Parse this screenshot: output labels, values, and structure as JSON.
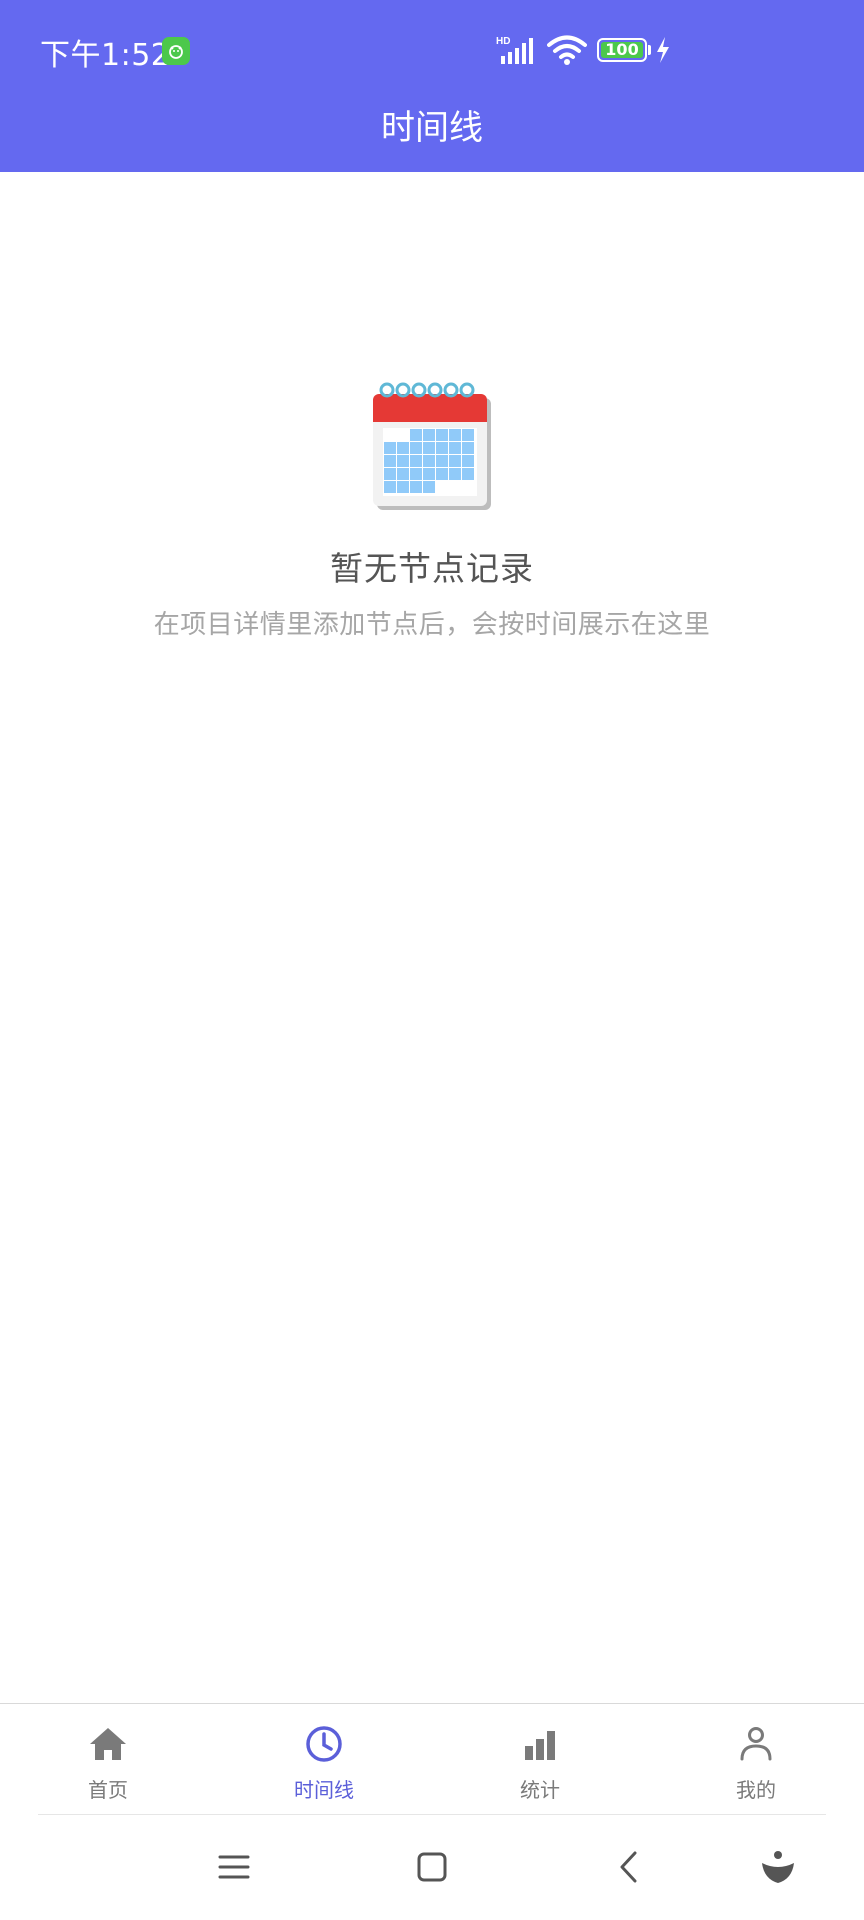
{
  "status_bar": {
    "time": "下午1:52",
    "network": "HD",
    "battery": "100"
  },
  "header": {
    "title": "时间线"
  },
  "empty_state": {
    "icon": "calendar-icon",
    "title": "暂无节点记录",
    "subtitle": "在项目详情里添加节点后，会按时间展示在这里"
  },
  "tabbar": {
    "tabs": [
      {
        "label": "首页",
        "icon": "home-icon",
        "active": false
      },
      {
        "label": "时间线",
        "icon": "clock-icon",
        "active": true
      },
      {
        "label": "统计",
        "icon": "bar-chart-icon",
        "active": false
      },
      {
        "label": "我的",
        "icon": "person-icon",
        "active": false
      }
    ]
  },
  "colors": {
    "header_bg": "#6469F0",
    "accent": "#5B5FD9",
    "inactive": "#7A7A7A",
    "battery_green": "#4CC84B"
  },
  "system_nav": {
    "buttons": [
      "menu-icon",
      "home-square-icon",
      "back-icon",
      "assistant-icon"
    ]
  }
}
